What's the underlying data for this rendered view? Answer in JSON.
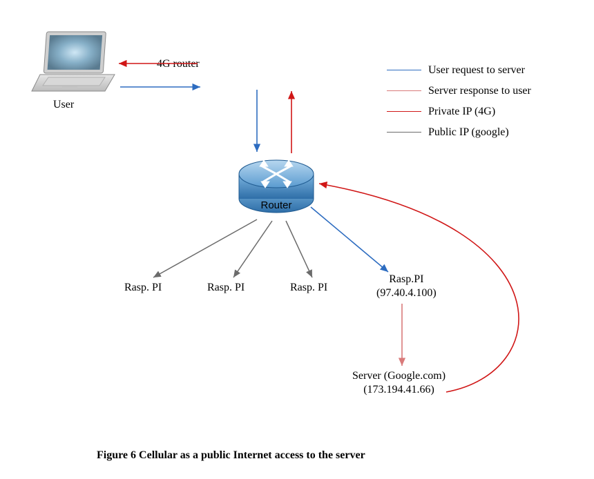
{
  "title": "Figure 6 Cellular as a public Internet access to the server",
  "legend": {
    "user_request": "User request to server",
    "server_response": "Server response to user",
    "private_ip": "Private IP (4G)",
    "public_ip": "Public IP (google)"
  },
  "nodes": {
    "user": "User",
    "router_4g": "4G router",
    "router_label": "Router",
    "pi_full": "Rasp.PI\n(97.40.4.100)",
    "pi_plain": "Rasp. PI",
    "server_google": "Server (Google.com)\n(173.194.41.66)"
  },
  "colors": {
    "blue": "#2d6cc0",
    "pink": "#d97a7a",
    "red": "#d01616",
    "gray": "#6b6b6b"
  }
}
